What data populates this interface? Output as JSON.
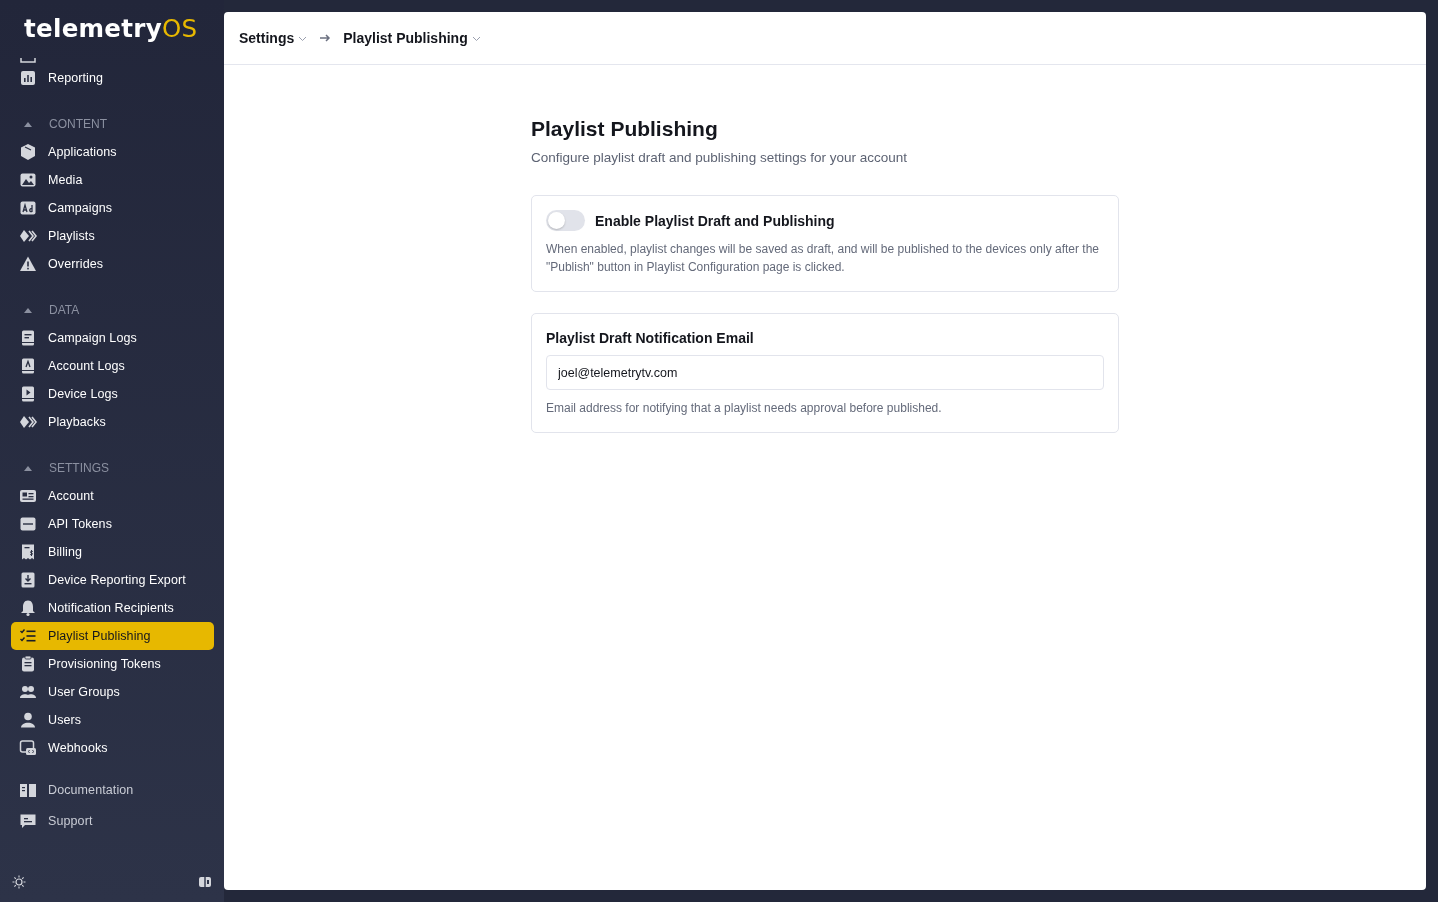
{
  "logo": {
    "text": "telemetry",
    "accent": "OS"
  },
  "sidebar": {
    "top_items": [
      {
        "label": "Reporting",
        "selected": false
      }
    ],
    "sections": [
      {
        "title": "CONTENT",
        "expanded": true,
        "items": [
          {
            "label": "Applications",
            "selected": false
          },
          {
            "label": "Media",
            "selected": false
          },
          {
            "label": "Campaigns",
            "selected": false
          },
          {
            "label": "Playlists",
            "selected": false
          },
          {
            "label": "Overrides",
            "selected": false
          }
        ]
      },
      {
        "title": "DATA",
        "expanded": true,
        "items": [
          {
            "label": "Campaign Logs",
            "selected": false
          },
          {
            "label": "Account Logs",
            "selected": false
          },
          {
            "label": "Device Logs",
            "selected": false
          },
          {
            "label": "Playbacks",
            "selected": false
          }
        ]
      },
      {
        "title": "SETTINGS",
        "expanded": true,
        "items": [
          {
            "label": "Account",
            "selected": false
          },
          {
            "label": "API Tokens",
            "selected": false
          },
          {
            "label": "Billing",
            "selected": false
          },
          {
            "label": "Device Reporting Export",
            "selected": false
          },
          {
            "label": "Notification Recipients",
            "selected": false
          },
          {
            "label": "Playlist Publishing",
            "selected": true
          },
          {
            "label": "Provisioning Tokens",
            "selected": false
          },
          {
            "label": "User Groups",
            "selected": false
          },
          {
            "label": "Users",
            "selected": false
          },
          {
            "label": "Webhooks",
            "selected": false
          }
        ]
      }
    ],
    "footer_links": [
      {
        "label": "Documentation"
      },
      {
        "label": "Support"
      }
    ]
  },
  "breadcrumb": [
    {
      "label": "Settings"
    },
    {
      "label": "Playlist Publishing"
    }
  ],
  "page": {
    "title": "Playlist Publishing",
    "subtitle": "Configure playlist draft and publishing settings for your account",
    "draft_card": {
      "label": "Enable Playlist Draft and Publishing",
      "on": false,
      "description": "When enabled, playlist changes will be saved as draft, and will be published to the devices only after the \"Publish\" button in Playlist Configuration page is clicked."
    },
    "email_card": {
      "label": "Playlist Draft Notification Email",
      "value": "joel@telemetrytv.com",
      "help": "Email address for notifying that a playlist needs approval before published."
    }
  }
}
